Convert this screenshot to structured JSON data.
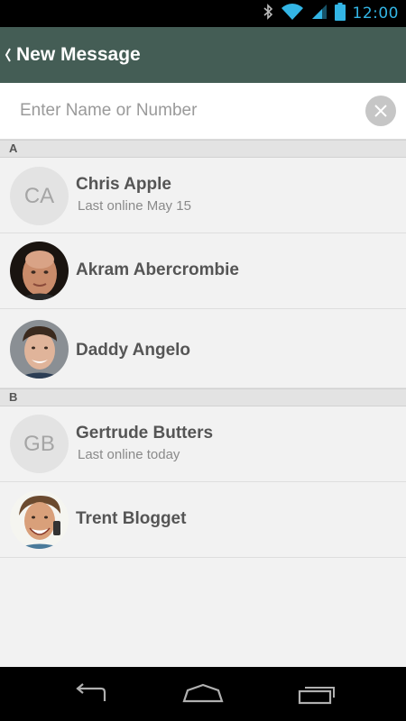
{
  "status_bar": {
    "time": "12:00",
    "icons": [
      "bluetooth-icon",
      "wifi-icon",
      "signal-icon",
      "battery-icon"
    ],
    "accent_color": "#33b5e5"
  },
  "action_bar": {
    "title": "New Message",
    "back_icon": "chevron-left-icon",
    "background_color": "#445d55"
  },
  "search": {
    "placeholder": "Enter Name or Number",
    "value": "",
    "clear_icon": "close-icon"
  },
  "sections": [
    {
      "letter": "A",
      "contacts": [
        {
          "name": "Chris Apple",
          "subtitle": "Last online May 15",
          "avatar_initials": "CA"
        },
        {
          "name": "Akram Abercrombie",
          "subtitle": "",
          "avatar_initials": ""
        },
        {
          "name": "Daddy Angelo",
          "subtitle": "",
          "avatar_initials": ""
        }
      ]
    },
    {
      "letter": "B",
      "contacts": [
        {
          "name": "Gertrude Butters",
          "subtitle": "Last online today",
          "avatar_initials": "GB"
        },
        {
          "name": "Trent Blogget",
          "subtitle": "",
          "avatar_initials": ""
        }
      ]
    }
  ],
  "nav_bar": {
    "buttons": [
      "back-nav-icon",
      "home-nav-icon",
      "recent-apps-icon"
    ]
  }
}
